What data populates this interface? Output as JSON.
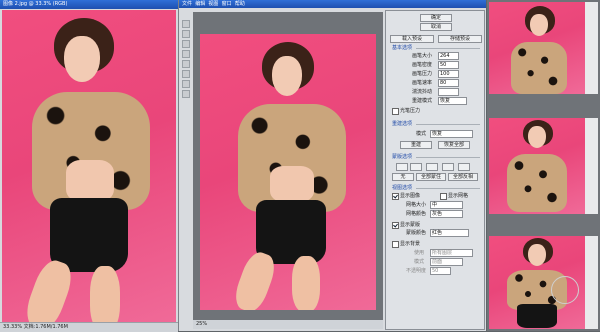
{
  "colors": {
    "pink": "#ee5486",
    "titlebar": "#2a63cf",
    "panel": "#dfe2e6",
    "workspace": "#6f7378"
  },
  "left_window": {
    "title": "图像 2.jpg @ 33.3% (RGB)",
    "status": "33.33% 文档:1.76M/1.76M"
  },
  "tools": [
    "move-tool",
    "marquee-tool",
    "lasso-tool",
    "crop-tool",
    "brush-tool",
    "eraser-tool",
    "zoom-tool",
    "hand-tool"
  ],
  "center": {
    "menu": [
      "文件",
      "编辑",
      "视图",
      "窗口",
      "帮助"
    ],
    "status": "25%"
  },
  "panel": {
    "ok": "确定",
    "cancel": "取消",
    "load": "载入预设",
    "save": "存储预设",
    "section_basic": "基本选项",
    "fields": [
      {
        "label": "画笔大小",
        "value": "264"
      },
      {
        "label": "画笔密度",
        "value": "50"
      },
      {
        "label": "画笔压力",
        "value": "100"
      },
      {
        "label": "画笔速率",
        "value": "80"
      },
      {
        "label": "湍流抖动",
        "value": ""
      },
      {
        "label": "重建模式",
        "value": "恢复"
      }
    ],
    "stylus": "光笔压力",
    "section_recon": "重建选项",
    "mode_label": "模式",
    "mode_value": "恢复",
    "reconstruct": "重建",
    "restore_all": "恢复全部",
    "section_mask": "蒙版选项",
    "mask_none": "无",
    "mask_all": "全部蒙住",
    "mask_invert": "全部反相",
    "section_view": "视图选项",
    "show_image": "显示图像",
    "show_mesh": "显示网格",
    "mesh_size": "网格大小",
    "mesh_size_value": "中",
    "mesh_color": "网格颜色",
    "mesh_color_value": "灰色",
    "show_mask": "显示蒙版",
    "mask_color": "蒙版颜色",
    "mask_color_value": "红色",
    "show_backdrop": "显示背景",
    "use": "使用",
    "use_value": "所有图层",
    "backdrop_mode": "模式",
    "backdrop_mode_value": "前面",
    "opacity": "不透明度",
    "opacity_value": "50"
  }
}
